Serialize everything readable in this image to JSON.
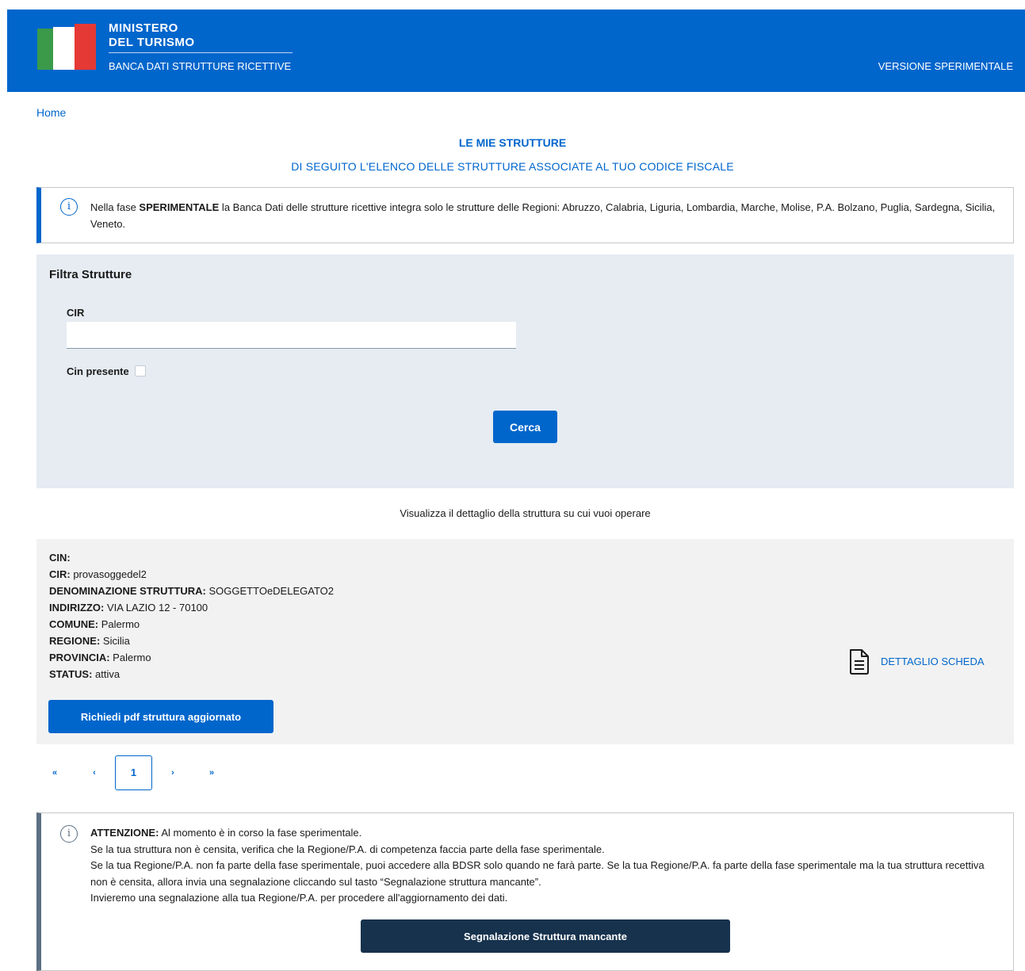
{
  "header": {
    "brand_line1": "MINISTERO",
    "brand_line2": "DEL TURISMO",
    "subtitle": "BANCA DATI STRUTTURE RICETTIVE",
    "version": "VERSIONE SPERIMENTALE",
    "logo_icon": "italian-flag-logo"
  },
  "breadcrumb": {
    "home": "Home"
  },
  "page": {
    "title": "LE MIE STRUTTURE",
    "subtitle": "DI SEGUITO L'ELENCO DELLE STRUTTURE ASSOCIATE AL TUO CODICE FISCALE"
  },
  "info": {
    "icon": "info-icon",
    "prefix": "Nella fase ",
    "strong": "SPERIMENTALE",
    "text": " la Banca Dati delle strutture ricettive integra solo le strutture delle Regioni: Abruzzo, Calabria, Liguria, Lombardia, Marche, Molise, P.A. Bolzano, Puglia, Sardegna, Sicilia, Veneto."
  },
  "filter": {
    "title": "Filtra Strutture",
    "cir_label": "CIR",
    "cir_value": "",
    "cin_label": "Cin presente",
    "cin_checked": false,
    "search_label": "Cerca"
  },
  "hint": "Visualizza il dettaglio della struttura su cui vuoi operare",
  "structure": {
    "cin_label": "CIN:",
    "cin_value": "",
    "cir_label": "CIR:",
    "cir_value": " provasoggedel2",
    "name_label": "DENOMINAZIONE STRUTTURA:",
    "name_value": " SOGGETTOeDELEGATO2",
    "address_label": "INDIRIZZO:",
    "address_value": " VIA LAZIO 12 - 70100",
    "comune_label": "COMUNE:",
    "comune_value": " Palermo",
    "regione_label": "REGIONE:",
    "regione_value": " Sicilia",
    "provincia_label": "PROVINCIA:",
    "provincia_value": " Palermo",
    "status_label": "STATUS:",
    "status_value": " attiva",
    "pdf_button": "Richiedi pdf struttura aggiornato",
    "detail_link": "DETTAGLIO SCHEDA",
    "detail_icon": "document-icon"
  },
  "pagination": {
    "first": "«",
    "prev": "‹",
    "current": "1",
    "next": "›",
    "last": "»"
  },
  "warning": {
    "icon": "info-icon",
    "strong": "ATTENZIONE:",
    "line1": " Al momento è in corso la fase sperimentale.",
    "line2": "Se la tua struttura non è censita, verifica che la Regione/P.A. di competenza faccia parte della fase sperimentale.",
    "line3": "Se la tua Regione/P.A. non fa parte della fase sperimentale, puoi accedere alla BDSR solo quando ne farà parte. Se la tua Regione/P.A. fa parte della fase sperimentale ma la tua struttura recettiva non è censita, allora invia una segnalazione cliccando sul tasto “Segnalazione struttura mancante”.",
    "line4": "Invieremo una segnalazione alla tua Regione/P.A. per procedere all'aggiornamento dei dati.",
    "button": "Segnalazione Struttura mancante"
  },
  "colors": {
    "primary": "#0066cc",
    "dark_button": "#17324d",
    "filter_bg": "#e6ecf2",
    "card_bg": "#f2f2f2"
  }
}
